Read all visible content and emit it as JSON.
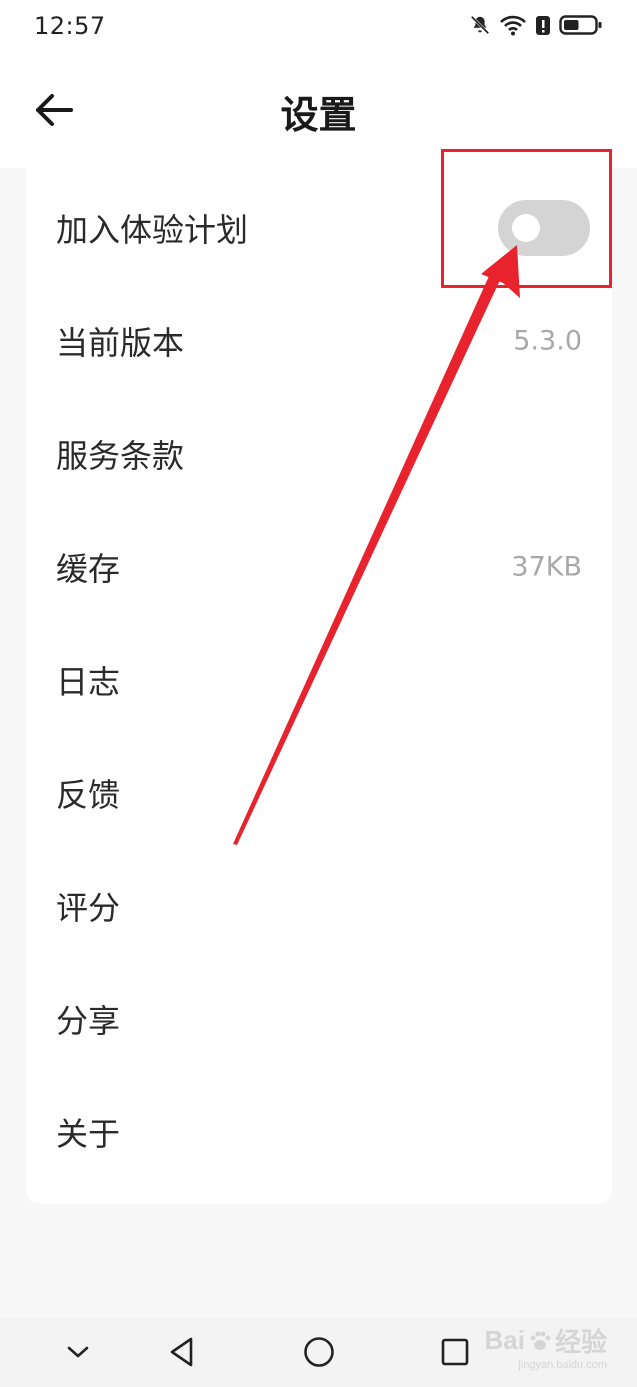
{
  "status_bar": {
    "time": "12:57",
    "icons": [
      "bell-off-icon",
      "wifi-icon",
      "battery-alert-icon",
      "battery-icon"
    ],
    "battery_level": 0.5
  },
  "header": {
    "title": "设置",
    "back_icon": "arrow-left-icon"
  },
  "settings": {
    "items": [
      {
        "label": "加入体验计划",
        "control": "toggle",
        "on": false
      },
      {
        "label": "当前版本",
        "value": "5.3.0"
      },
      {
        "label": "服务条款"
      },
      {
        "label": "缓存",
        "value": "37KB"
      },
      {
        "label": "日志"
      },
      {
        "label": "反馈"
      },
      {
        "label": "评分"
      },
      {
        "label": "分享"
      },
      {
        "label": "关于"
      }
    ]
  },
  "annotation": {
    "color": "#e8232d",
    "shape": "highlight-box-with-arrow"
  },
  "nav_bar": {
    "buttons": [
      "chevron-down-icon",
      "back-triangle-icon",
      "home-circle-icon",
      "recents-square-icon"
    ]
  },
  "watermark": {
    "logo_text": "Bai",
    "logo_text_suffix": "经验",
    "url": "jingyan.baidu.com"
  }
}
